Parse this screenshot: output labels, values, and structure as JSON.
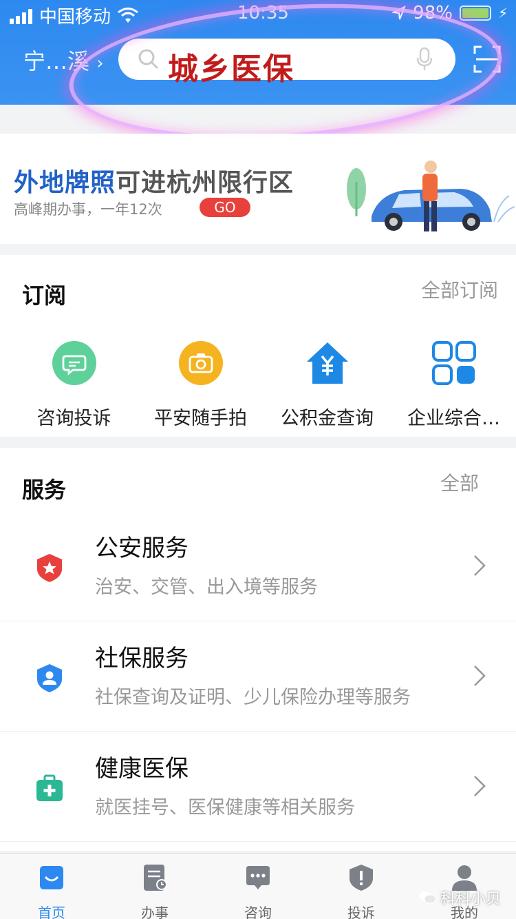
{
  "status_bar": {
    "carrier": "中国移动",
    "time": "10:35",
    "battery": "98%"
  },
  "header": {
    "city": "宁…溪",
    "search_text": "城乡医保"
  },
  "banner": {
    "title_highlight": "外地牌照",
    "title_rest": "可进杭州限行区",
    "subtitle": "高峰期办事，一年12次",
    "go_label": "GO"
  },
  "subscribe": {
    "title": "订阅",
    "more": "全部订阅",
    "items": [
      {
        "label": "咨询投诉",
        "icon": "chat-bubble-icon",
        "color": "#5ed19a"
      },
      {
        "label": "平安随手拍",
        "icon": "camera-icon",
        "color": "#f5b320"
      },
      {
        "label": "公积金查询",
        "icon": "house-yen-icon",
        "color": "#1e88e5"
      },
      {
        "label": "企业综合…",
        "icon": "grid-icon",
        "color": "#1e88e5"
      }
    ]
  },
  "services": {
    "title": "服务",
    "more": "全部",
    "items": [
      {
        "title": "公安服务",
        "desc": "治安、交管、出入境等服务",
        "icon": "police-shield-icon",
        "color": "#e8403c"
      },
      {
        "title": "社保服务",
        "desc": "社保查询及证明、少儿保险办理等服务",
        "icon": "person-shield-icon",
        "color": "#2d89f0"
      },
      {
        "title": "健康医保",
        "desc": "就医挂号、医保健康等相关服务",
        "icon": "medical-kit-icon",
        "color": "#2bb894"
      }
    ]
  },
  "tabbar": {
    "items": [
      {
        "label": "首页",
        "icon": "home-icon",
        "active": true
      },
      {
        "label": "办事",
        "icon": "document-icon",
        "active": false
      },
      {
        "label": "咨询",
        "icon": "chat-icon",
        "active": false
      },
      {
        "label": "投诉",
        "icon": "shield-alert-icon",
        "active": false
      },
      {
        "label": "我的",
        "icon": "user-icon",
        "active": false
      }
    ],
    "watermark": "科科小贝"
  },
  "colors": {
    "brand_blue": "#2d89f0",
    "go_red": "#e8403c",
    "annotation_ring": "#e8aaff"
  }
}
